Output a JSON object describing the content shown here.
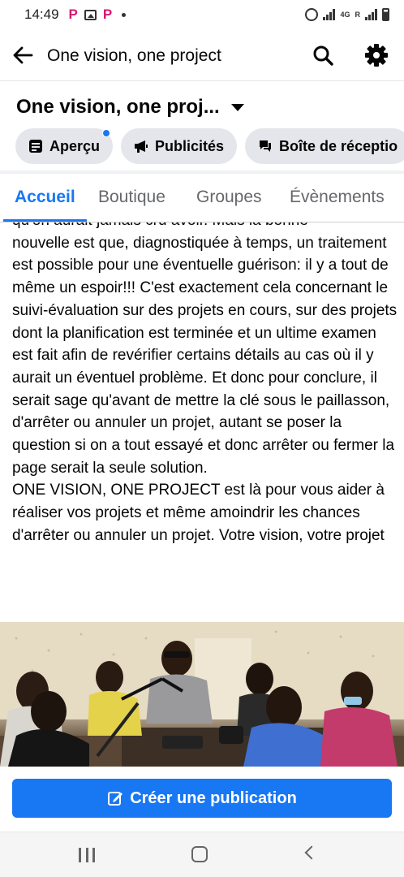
{
  "status_bar": {
    "time": "14:49",
    "notification_letters": [
      "P",
      "P"
    ],
    "network": "4G",
    "network_r": "R"
  },
  "header": {
    "title": "One vision, one project"
  },
  "page": {
    "name": "One vision, one proj..."
  },
  "chips": [
    {
      "label": "Aperçu",
      "icon": "overview-icon"
    },
    {
      "label": "Publicités",
      "icon": "megaphone-icon"
    },
    {
      "label": "Boîte de réceptio",
      "icon": "chat-icon"
    }
  ],
  "tabs": [
    {
      "label": "Accueil",
      "active": true
    },
    {
      "label": "Boutique",
      "active": false
    },
    {
      "label": "Groupes",
      "active": false
    },
    {
      "label": "Évènements",
      "active": false
    }
  ],
  "post": {
    "partial_line": "qu'on aurait jamais cru avoir. Mais la bonne",
    "paragraph_1": "nouvelle est que, diagnostiquée à temps,  un traitement est possible pour une éventuelle guérison: il y a tout de même un espoir!!! C'est exactement cela concernant le suivi-évaluation sur des projets en cours, sur des projets dont la planification est terminée et un ultime examen est fait afin de revérifier certains détails au cas où il y aurait un éventuel problème. Et donc pour conclure, il serait  sage qu'avant de mettre la clé sous le paillasson, d'arrêter ou annuler un projet, autant se poser la question si on a tout essayé et donc arrêter ou fermer  la page serait la seule solution.",
    "paragraph_2": "ONE VISION,  ONE PROJECT est là pour vous aider à réaliser vos projets et même amoindrir les chances d'arrêter ou annuler un projet. Votre vision, votre projet"
  },
  "create_button": {
    "label": "Créer une publication"
  },
  "colors": {
    "accent": "#1877f2",
    "chip_bg": "#e4e6eb",
    "text": "#050505",
    "muted": "#65676b"
  }
}
